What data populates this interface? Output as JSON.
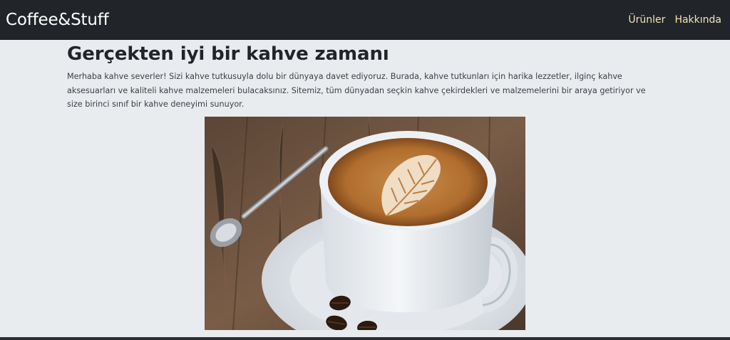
{
  "navbar": {
    "brand": "Coffee&Stuff",
    "links": [
      {
        "label": "Ürünler"
      },
      {
        "label": "Hakkında"
      }
    ]
  },
  "main": {
    "title": "Gerçekten iyi bir kahve zamanı",
    "intro": "Merhaba kahve severler! Sizi kahve tutkusuyla dolu bir dünyaya davet ediyoruz. Burada, kahve tutkunları için harika lezzetler, ilginç kahve aksesuarları ve kaliteli kahve malzemeleri bulacaksınız. Sitemiz, tüm dünyadan seçkin kahve çekirdekleri ve malzemelerini bir araya getiriyor ve size birinci sınıf bir kahve deneyimi sunuyor."
  },
  "colors": {
    "navbar_bg": "#212529",
    "nav_link": "#f3e3b5",
    "page_bg": "#e9ecef"
  }
}
